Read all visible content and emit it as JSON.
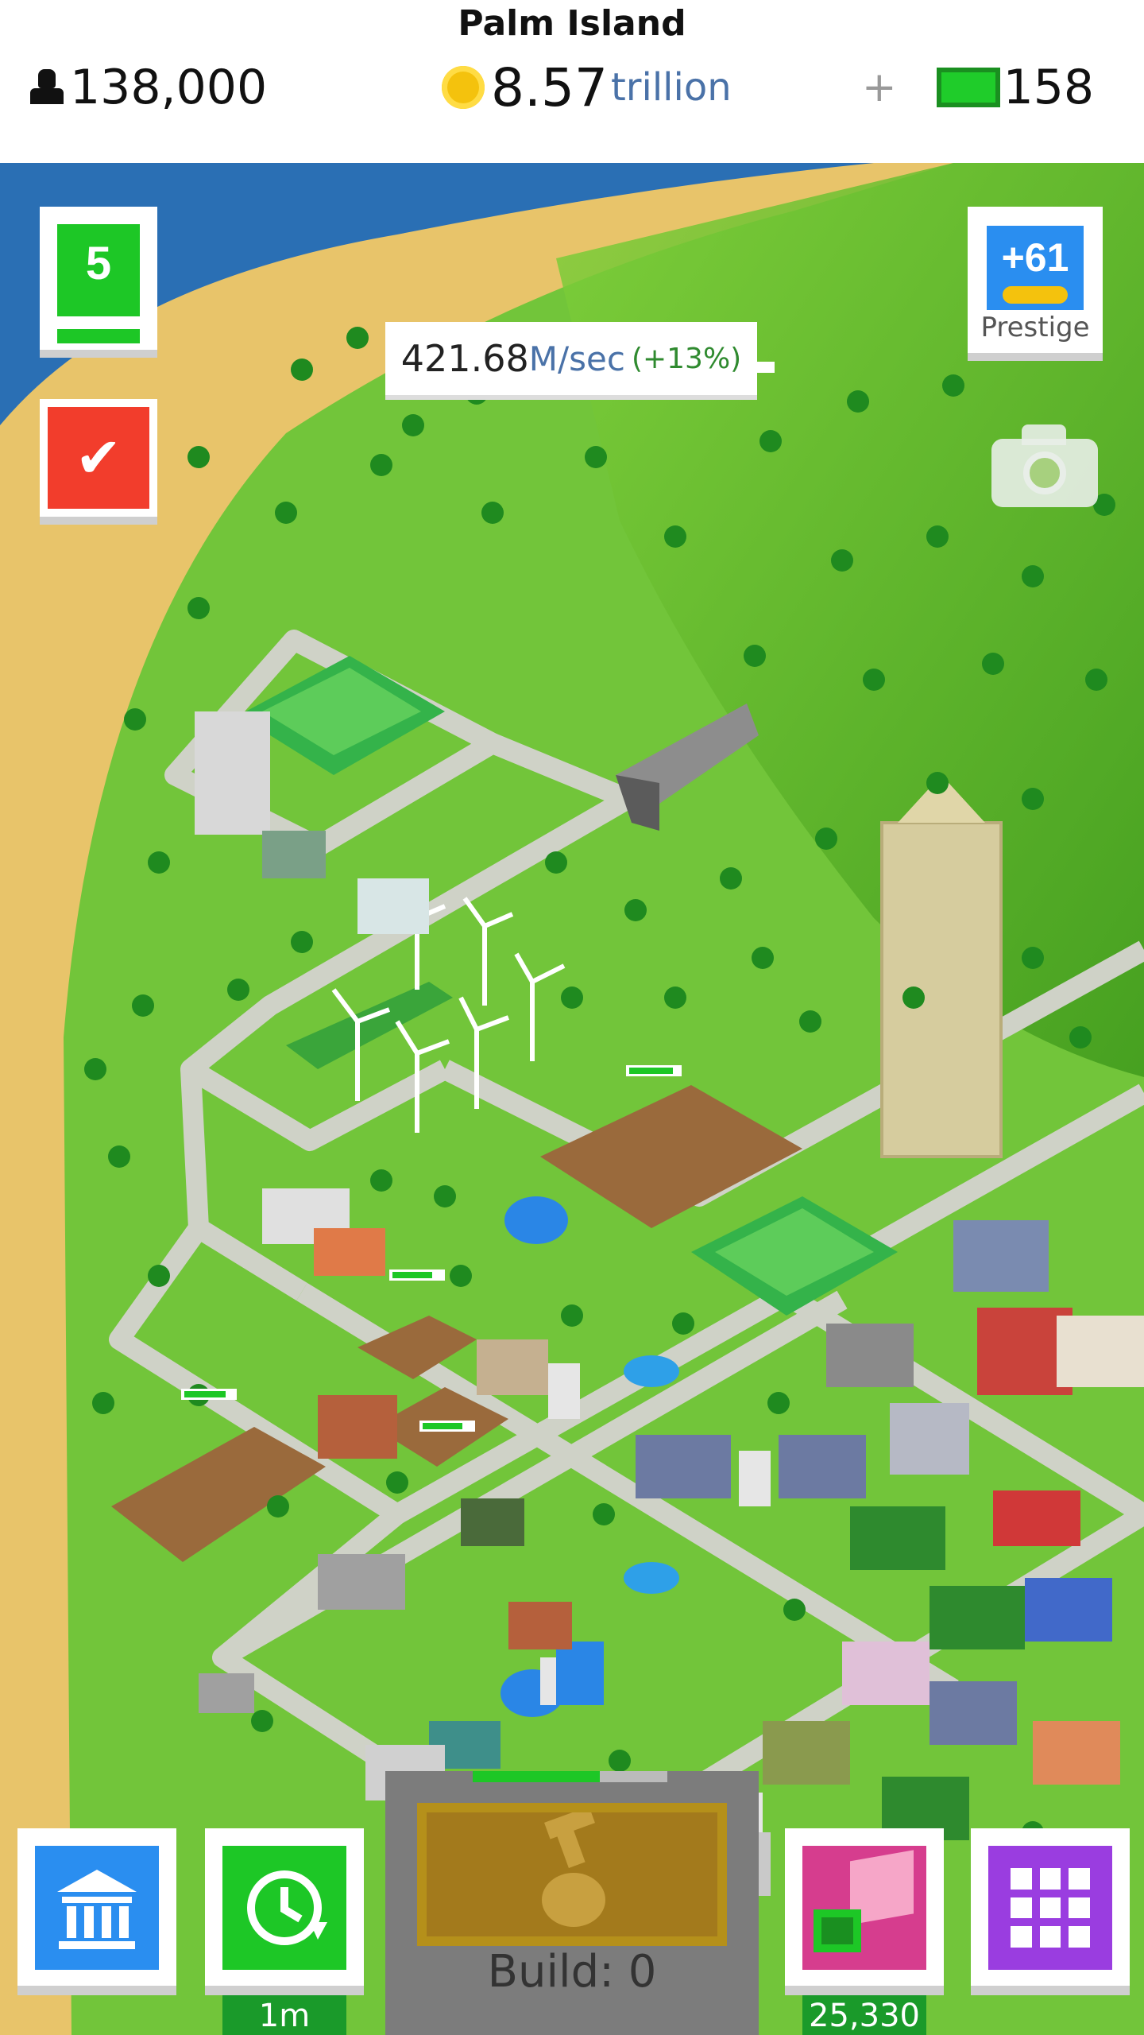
{
  "header": {
    "city_name": "Palm Island",
    "population": "138,000",
    "money_value": "8.57",
    "money_unit": "trillion",
    "plus_sign": "+",
    "cash": "158"
  },
  "income": {
    "value": "421.68",
    "unit": "M/sec",
    "boost": "(+13%)"
  },
  "level_badge": {
    "level": "5"
  },
  "prestige": {
    "value": "+61",
    "label": "Prestige"
  },
  "buttons": {
    "timer_label": "1m",
    "piggy_bank_label": "25,330",
    "build_label": "Build: 0"
  },
  "icons": {
    "population": "person-icon",
    "money": "coin-icon",
    "cash": "cash-bill-icon",
    "checklist": "checkmark-icon",
    "prestige": "key-icon",
    "camera": "camera-icon",
    "bank": "bank-icon",
    "timer": "clock-refresh-icon",
    "build": "hammer-hand-icon",
    "piggy_bank": "piggy-bank-icon",
    "menu": "grid-icon"
  },
  "colors": {
    "accent_green": "#1dc726",
    "accent_blue": "#2a8ef0",
    "accent_red": "#f23d2c",
    "accent_purple": "#9a3de0",
    "accent_pink": "#d63d8e",
    "money_unit_blue": "#4a72a8"
  }
}
